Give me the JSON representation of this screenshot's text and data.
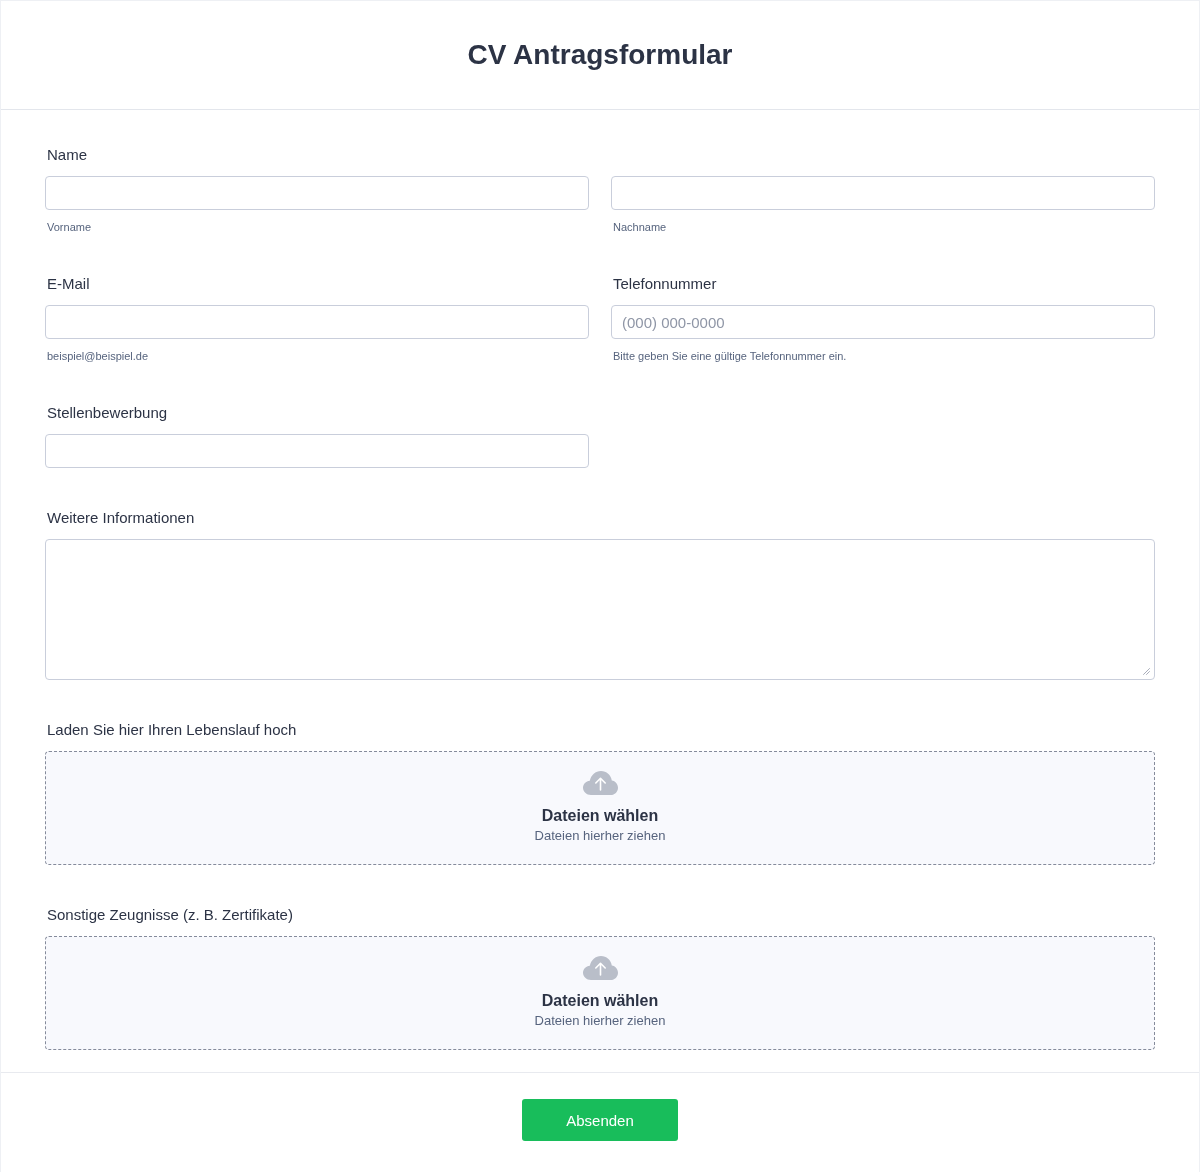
{
  "header": {
    "title": "CV Antragsformular"
  },
  "name_field": {
    "label": "Name",
    "parts": [
      {
        "sublabel": "Vorname"
      },
      {
        "sublabel": "Nachname"
      }
    ]
  },
  "contact_fields": [
    {
      "label": "E-Mail",
      "sublabel": "beispiel@beispiel.de"
    },
    {
      "label": "Telefonnummer",
      "placeholder": "(000) 000-0000",
      "sublabel": "Bitte geben Sie eine gültige Telefonnummer ein."
    }
  ],
  "position_field": {
    "label": "Stellenbewerbung"
  },
  "info_field": {
    "label": "Weitere Informationen"
  },
  "uploads": [
    {
      "label": "Laden Sie hier Ihren Lebenslauf hoch",
      "button": "Dateien wählen",
      "hint": "Dateien hierher ziehen"
    },
    {
      "label": "Sonstige Zeugnisse (z. B. Zertifikate)",
      "button": "Dateien wählen",
      "hint": "Dateien hierher ziehen"
    }
  ],
  "submit": {
    "label": "Absenden"
  }
}
